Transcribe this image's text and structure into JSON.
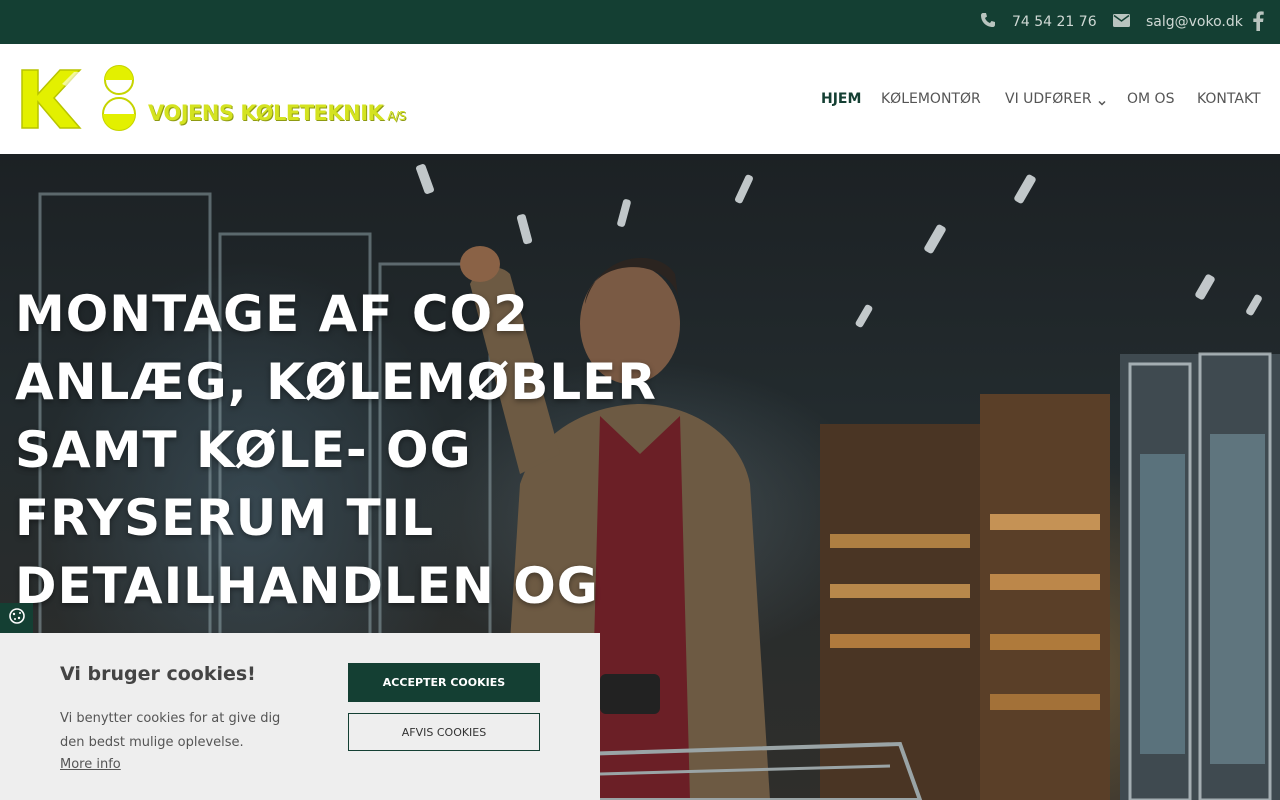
{
  "topbar": {
    "phone": "74 54 21 76",
    "email": "salg@voko.dk",
    "phone_icon": "phone-icon",
    "mail_icon": "envelope-icon",
    "facebook_icon": "facebook-icon"
  },
  "header": {
    "logo_text": "VOJENS KØLETEKNIK",
    "logo_suffix": "A/S",
    "nav": [
      {
        "label": "HJEM",
        "active": true
      },
      {
        "label": "KØLEMONTØR",
        "active": false
      },
      {
        "label": "VI UDFØRER",
        "active": false,
        "has_dropdown": true
      },
      {
        "label": "OM OS",
        "active": false
      },
      {
        "label": "KONTAKT",
        "active": false
      }
    ]
  },
  "hero": {
    "title": "MONTAGE AF CO2 ANLÆG, KØLEMØBLER SAMT KØLE- OG FRYSERUM TIL DETAILHANDLEN OG INDUSTRI"
  },
  "cookie": {
    "title": "Vi bruger cookies!",
    "text": "Vi benytter cookies for at give dig den bedst mulige oplevelse.",
    "more_info": "More info",
    "accept": "ACCEPTER COOKIES",
    "decline": "AFVIS COOKIES",
    "settings_icon": "cookie-icon"
  },
  "colors": {
    "brand_green": "#143f33",
    "logo_yellow": "#d4e320"
  }
}
